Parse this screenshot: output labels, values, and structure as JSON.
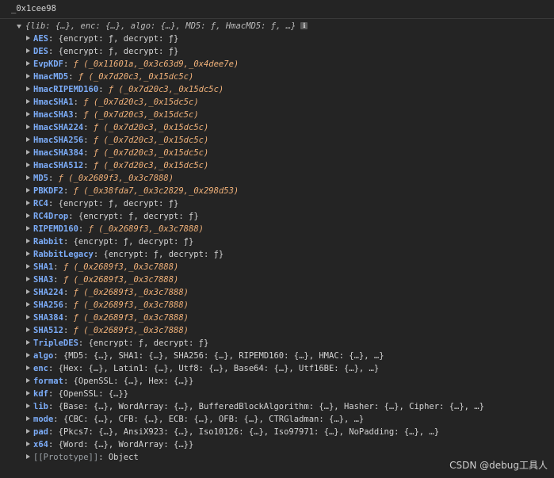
{
  "console": {
    "input": "_0x1cee98",
    "root_preview": "{lib: {…}, enc: {…}, algo: {…}, MD5: ƒ, HmacMD5: ƒ, …}",
    "info_glyph": "i"
  },
  "properties": [
    {
      "key": "AES",
      "kind": "obj",
      "value": "{encrypt: ƒ, decrypt: ƒ}"
    },
    {
      "key": "DES",
      "kind": "obj",
      "value": "{encrypt: ƒ, decrypt: ƒ}"
    },
    {
      "key": "EvpKDF",
      "kind": "fn",
      "value": "(_0x11601a,_0x3c63d9,_0x4dee7e)"
    },
    {
      "key": "HmacMD5",
      "kind": "fn",
      "value": "(_0x7d20c3,_0x15dc5c)"
    },
    {
      "key": "HmacRIPEMD160",
      "kind": "fn",
      "value": "(_0x7d20c3,_0x15dc5c)"
    },
    {
      "key": "HmacSHA1",
      "kind": "fn",
      "value": "(_0x7d20c3,_0x15dc5c)"
    },
    {
      "key": "HmacSHA3",
      "kind": "fn",
      "value": "(_0x7d20c3,_0x15dc5c)"
    },
    {
      "key": "HmacSHA224",
      "kind": "fn",
      "value": "(_0x7d20c3,_0x15dc5c)"
    },
    {
      "key": "HmacSHA256",
      "kind": "fn",
      "value": "(_0x7d20c3,_0x15dc5c)"
    },
    {
      "key": "HmacSHA384",
      "kind": "fn",
      "value": "(_0x7d20c3,_0x15dc5c)"
    },
    {
      "key": "HmacSHA512",
      "kind": "fn",
      "value": "(_0x7d20c3,_0x15dc5c)"
    },
    {
      "key": "MD5",
      "kind": "fn",
      "value": "(_0x2689f3,_0x3c7888)"
    },
    {
      "key": "PBKDF2",
      "kind": "fn",
      "value": "(_0x38fda7,_0x3c2829,_0x298d53)"
    },
    {
      "key": "RC4",
      "kind": "obj",
      "value": "{encrypt: ƒ, decrypt: ƒ}"
    },
    {
      "key": "RC4Drop",
      "kind": "obj",
      "value": "{encrypt: ƒ, decrypt: ƒ}"
    },
    {
      "key": "RIPEMD160",
      "kind": "fn",
      "value": "(_0x2689f3,_0x3c7888)"
    },
    {
      "key": "Rabbit",
      "kind": "obj",
      "value": "{encrypt: ƒ, decrypt: ƒ}"
    },
    {
      "key": "RabbitLegacy",
      "kind": "obj",
      "value": "{encrypt: ƒ, decrypt: ƒ}"
    },
    {
      "key": "SHA1",
      "kind": "fn",
      "value": "(_0x2689f3,_0x3c7888)"
    },
    {
      "key": "SHA3",
      "kind": "fn",
      "value": "(_0x2689f3,_0x3c7888)"
    },
    {
      "key": "SHA224",
      "kind": "fn",
      "value": "(_0x2689f3,_0x3c7888)"
    },
    {
      "key": "SHA256",
      "kind": "fn",
      "value": "(_0x2689f3,_0x3c7888)"
    },
    {
      "key": "SHA384",
      "kind": "fn",
      "value": "(_0x2689f3,_0x3c7888)"
    },
    {
      "key": "SHA512",
      "kind": "fn",
      "value": "(_0x2689f3,_0x3c7888)"
    },
    {
      "key": "TripleDES",
      "kind": "obj",
      "value": "{encrypt: ƒ, decrypt: ƒ}"
    },
    {
      "key": "algo",
      "kind": "obj",
      "value": "{MD5: {…}, SHA1: {…}, SHA256: {…}, RIPEMD160: {…}, HMAC: {…}, …}"
    },
    {
      "key": "enc",
      "kind": "obj",
      "value": "{Hex: {…}, Latin1: {…}, Utf8: {…}, Base64: {…}, Utf16BE: {…}, …}"
    },
    {
      "key": "format",
      "kind": "obj",
      "value": "{OpenSSL: {…}, Hex: {…}}"
    },
    {
      "key": "kdf",
      "kind": "obj",
      "value": "{OpenSSL: {…}}"
    },
    {
      "key": "lib",
      "kind": "obj",
      "value": "{Base: {…}, WordArray: {…}, BufferedBlockAlgorithm: {…}, Hasher: {…}, Cipher: {…}, …}"
    },
    {
      "key": "mode",
      "kind": "obj",
      "value": "{CBC: {…}, CFB: {…}, ECB: {…}, OFB: {…}, CTRGladman: {…}, …}"
    },
    {
      "key": "pad",
      "kind": "obj",
      "value": "{Pkcs7: {…}, AnsiX923: {…}, Iso10126: {…}, Iso97971: {…}, NoPadding: {…}, …}"
    },
    {
      "key": "x64",
      "kind": "obj",
      "value": "{Word: {…}, WordArray: {…}}"
    }
  ],
  "prototype": {
    "key": "[[Prototype]]",
    "value": "Object"
  },
  "fn_glyph": "ƒ",
  "watermark": "CSDN @debug工具人",
  "colors": {
    "background": "#242424",
    "key": "#7cacf8",
    "function": "#f2b27a",
    "text": "#d4d4d4",
    "prototype": "#9aa0a6"
  }
}
